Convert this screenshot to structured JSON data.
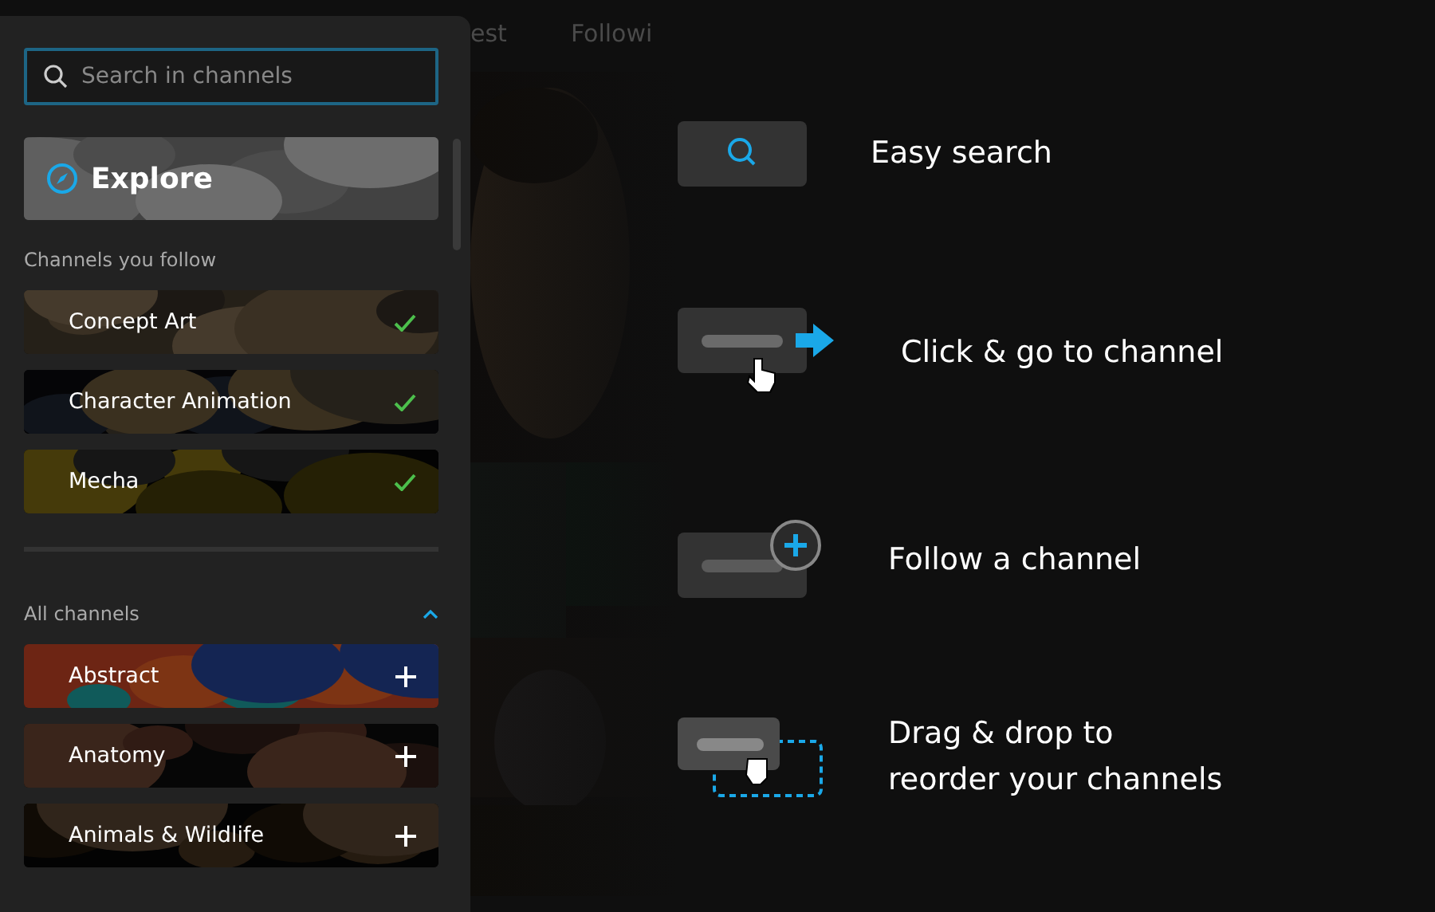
{
  "background_nav": [
    "est",
    "Followi"
  ],
  "search": {
    "placeholder": "Search in channels"
  },
  "explore": {
    "label": "Explore"
  },
  "followed": {
    "heading": "Channels you follow",
    "channels": [
      {
        "name": "Concept Art",
        "following": true
      },
      {
        "name": "Character Animation",
        "following": true
      },
      {
        "name": "Mecha",
        "following": true
      }
    ]
  },
  "all": {
    "heading": "All channels",
    "expanded": true,
    "channels": [
      {
        "name": "Abstract",
        "following": false
      },
      {
        "name": "Anatomy",
        "following": false
      },
      {
        "name": "Animals & Wildlife",
        "following": false
      }
    ]
  },
  "tips": [
    {
      "kind": "search",
      "text": "Easy search"
    },
    {
      "kind": "click",
      "text": "Click & go to channel"
    },
    {
      "kind": "follow",
      "text": "Follow a channel"
    },
    {
      "kind": "drag",
      "text": "Drag & drop to\nreorder your channels"
    }
  ]
}
